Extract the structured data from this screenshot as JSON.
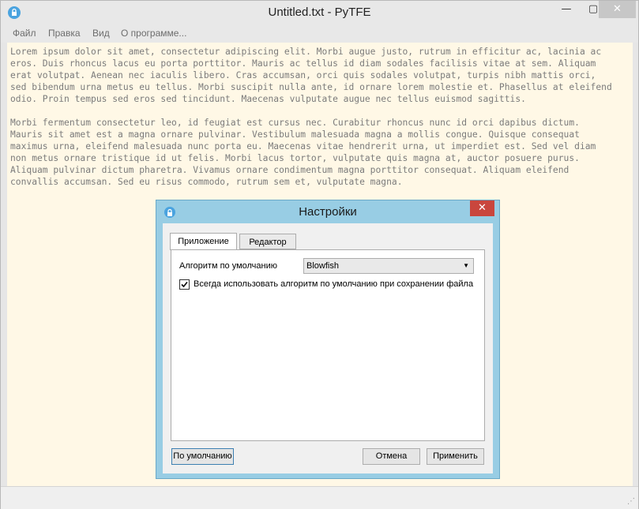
{
  "window": {
    "title": "Untitled.txt - PyTFE",
    "min": "—",
    "max": "▢",
    "close": "✕"
  },
  "menu": {
    "items": [
      "Файл",
      "Правка",
      "Вид",
      "О программе..."
    ]
  },
  "editor": {
    "text": "Lorem ipsum dolor sit amet, consectetur adipiscing elit. Morbi augue justo, rutrum in efficitur ac, lacinia ac\neros. Duis rhoncus lacus eu porta porttitor. Mauris ac tellus id diam sodales facilisis vitae at sem. Aliquam\nerat volutpat. Aenean nec iaculis libero. Cras accumsan, orci quis sodales volutpat, turpis nibh mattis orci,\nsed bibendum urna metus eu tellus. Morbi suscipit nulla ante, id ornare lorem molestie et. Phasellus at eleifend\nodio. Proin tempus sed eros sed tincidunt. Maecenas vulputate augue nec tellus euismod sagittis.\n\nMorbi fermentum consectetur leo, id feugiat est cursus nec. Curabitur rhoncus nunc id orci dapibus dictum.\nMauris sit amet est a magna ornare pulvinar. Vestibulum malesuada magna a mollis congue. Quisque consequat\nmaximus urna, eleifend malesuada nunc porta eu. Maecenas vitae hendrerit urna, ut imperdiet est. Sed vel diam\nnon metus ornare tristique id ut felis. Morbi lacus tortor, vulputate quis magna at, auctor posuere purus.\nAliquam pulvinar dictum pharetra. Vivamus ornare condimentum magna porttitor consequat. Aliquam eleifend\nconvallis accumsan. Sed eu risus commodo, rutrum sem et, vulputate magna."
  },
  "dialog": {
    "title": "Настройки",
    "close": "✕",
    "tabs": [
      "Приложение",
      "Редактор"
    ],
    "algorithm_label": "Алгоритм по умолчанию",
    "algorithm_value": "Blowfish",
    "select_arrow": "▼",
    "always_use_label": "Всегда использовать алгоритм по умолчанию при сохранении файла",
    "always_use_checked": true,
    "buttons": {
      "defaults": "По умолчанию",
      "cancel": "Отмена",
      "apply": "Применить"
    }
  },
  "statusbar": {
    "grip": "⋰"
  },
  "colors": {
    "editor_bg": "#fff8e6",
    "dialog_frame": "#98cde4",
    "close_red": "#c9463d",
    "icon_blue": "#4aa3df"
  },
  "icons": {
    "app": "lock-icon",
    "dialog": "lock-icon",
    "checkbox": "checkmark-icon"
  }
}
